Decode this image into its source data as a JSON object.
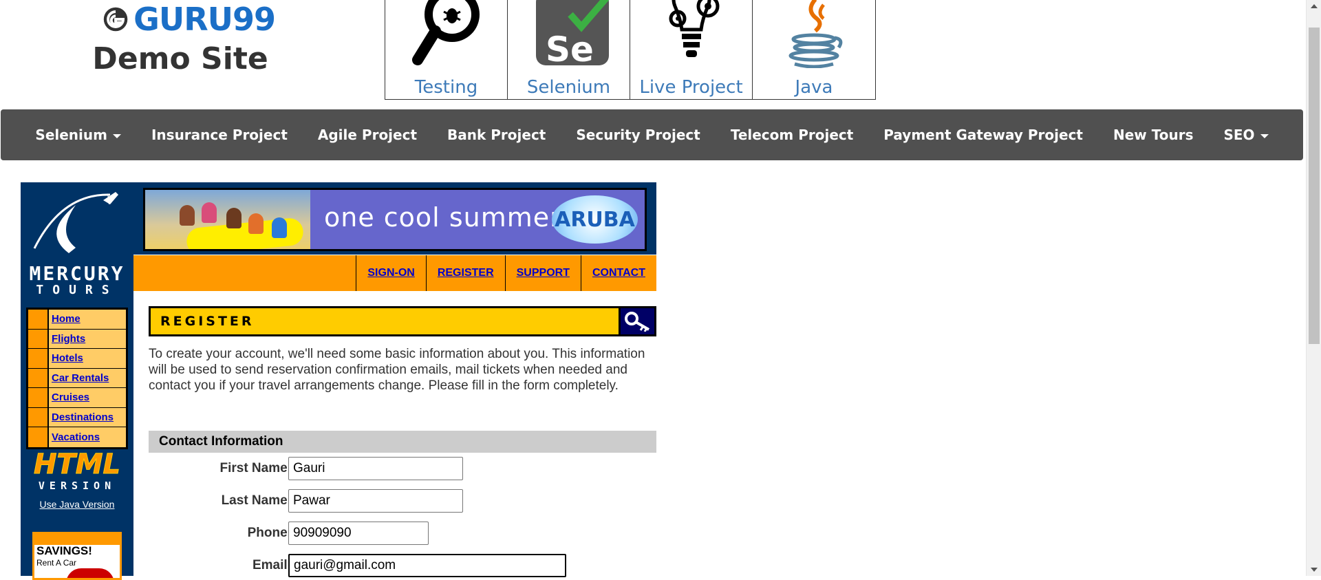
{
  "site": {
    "logo_text": "GURU99",
    "subtitle": "Demo Site"
  },
  "course_tiles": [
    {
      "label": "Testing",
      "icon": "magnifier-bug-icon"
    },
    {
      "label": "Selenium",
      "icon": "selenium-logo-icon"
    },
    {
      "label": "Live Project",
      "icon": "lightbulb-gears-icon"
    },
    {
      "label": "Java",
      "icon": "java-cup-icon"
    }
  ],
  "nav": {
    "items": [
      {
        "label": "Selenium",
        "dropdown": true
      },
      {
        "label": "Insurance Project",
        "dropdown": false
      },
      {
        "label": "Agile Project",
        "dropdown": false
      },
      {
        "label": "Bank Project",
        "dropdown": false
      },
      {
        "label": "Security Project",
        "dropdown": false
      },
      {
        "label": "Telecom Project",
        "dropdown": false
      },
      {
        "label": "Payment Gateway Project",
        "dropdown": false
      },
      {
        "label": "New Tours",
        "dropdown": false
      },
      {
        "label": "SEO",
        "dropdown": true
      }
    ]
  },
  "mercury": {
    "logo_line1": "MERCURY",
    "logo_line2": "TOURS",
    "side_menu": [
      "Home",
      "Flights",
      "Hotels",
      "Car Rentals",
      "Cruises",
      "Destinations",
      "Vacations"
    ],
    "html_version_line1": "HTML",
    "html_version_line2": "VERSION",
    "java_link": "Use Java Version",
    "savings_title": "SAVINGS!",
    "savings_sub": "Rent A Car",
    "banner_text": "one cool summer",
    "banner_brand": "ARUBA",
    "top_links": [
      "SIGN-ON",
      "REGISTER",
      "SUPPORT",
      "CONTACT"
    ]
  },
  "register": {
    "title": "REGISTER",
    "intro": "To create your account, we'll need some basic information about you. This information will be used to send reservation confirmation emails, mail tickets when needed and contact you if your travel arrangements change. Please fill in the form completely.",
    "section_title": "Contact Information",
    "fields": {
      "first_name": {
        "label": "First Name:",
        "value": "Gauri"
      },
      "last_name": {
        "label": "Last Name:",
        "value": "Pawar"
      },
      "phone": {
        "label": "Phone:",
        "value": "90909090"
      },
      "email": {
        "label": "Email:",
        "value": "gauri@gmail.com"
      }
    }
  },
  "colors": {
    "nav_bg": "#505050",
    "brand_blue": "#1b6fc7",
    "mercury_navy": "#003366",
    "mercury_orange": "#ff9900",
    "register_yellow": "#ffcc00"
  }
}
